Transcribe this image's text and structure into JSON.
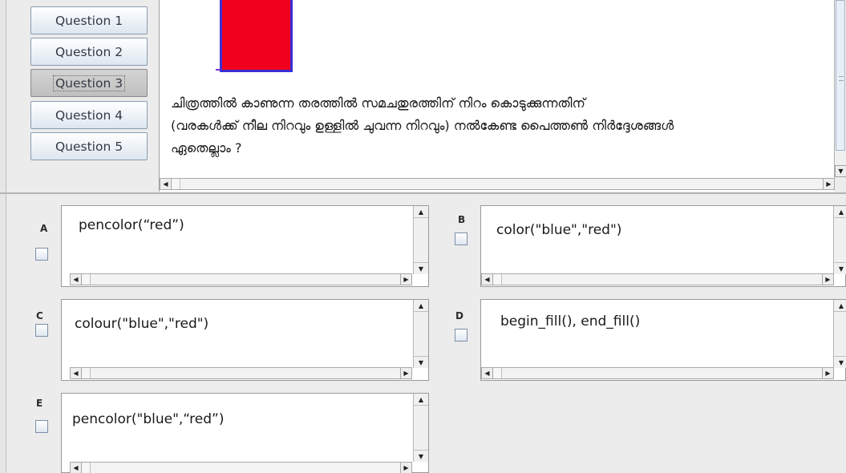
{
  "questions_nav": [
    {
      "label": "Question 1",
      "selected": false
    },
    {
      "label": "Question 2",
      "selected": false
    },
    {
      "label": "Question 3",
      "selected": true
    },
    {
      "label": "Question 4",
      "selected": false
    },
    {
      "label": "Question 5",
      "selected": false
    }
  ],
  "question": {
    "text_lines": [
      "ചിത്രത്തിൽ കാണുന്ന തരത്തിൽ സമചതുരത്തിന് നിറം കൊടുക്കുന്നതിന്",
      "(വരകൾക്ക് നീല നിറവും ഉള്ളിൽ ചുവന്ന നിറവും) നൽകേണ്ട പൈത്തൺ നിർദ്ദേശങ്ങൾ",
      "ഏതെല്ലാം ?"
    ],
    "figure": {
      "fill_color": "#f0001d",
      "border_color": "#3a2fd6"
    }
  },
  "options": [
    {
      "letter": "A",
      "text": "pencolor(“red”)",
      "checked": false
    },
    {
      "letter": "B",
      "text": "color(\"blue\",\"red\")",
      "checked": false
    },
    {
      "letter": "C",
      "text": "colour(\"blue\",\"red\")",
      "checked": false
    },
    {
      "letter": "D",
      "text": "begin_fill(), end_fill()",
      "checked": false
    },
    {
      "letter": "E",
      "text": "pencolor(\"blue\",“red”)",
      "checked": false
    }
  ],
  "icons": {
    "scroll_up": "▲",
    "scroll_down": "▼",
    "scroll_left": "◀",
    "scroll_right": "▶"
  }
}
